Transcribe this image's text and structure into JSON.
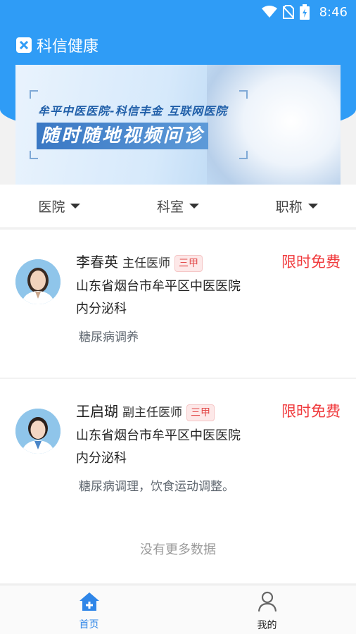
{
  "status_bar": {
    "time": "8:46"
  },
  "app": {
    "title": "科信健康"
  },
  "banner": {
    "line1": "牟平中医医院-科信丰金  互联网医院",
    "line2": "随时随地视频问诊"
  },
  "filters": [
    {
      "label": "医院"
    },
    {
      "label": "科室"
    },
    {
      "label": "职称"
    }
  ],
  "doctors": [
    {
      "name": "李春英",
      "title": "主任医师",
      "badge": "三甲",
      "price": "限时免费",
      "hospital": "山东省烟台市牟平区中医医院",
      "department": "内分泌科",
      "specialty": "糖尿病调养"
    },
    {
      "name": "王启瑚",
      "title": "副主任医师",
      "badge": "三甲",
      "price": "限时免费",
      "hospital": "山东省烟台市牟平区中医医院",
      "department": "内分泌科",
      "specialty": "糖尿病调理，饮食运动调整。"
    }
  ],
  "list_footer": "没有更多数据",
  "tabbar": [
    {
      "label": "首页",
      "icon": "home-plus-icon",
      "active": true
    },
    {
      "label": "我的",
      "icon": "person-icon",
      "active": false
    }
  ],
  "colors": {
    "primary": "#2f9cf6",
    "price": "#f0383b",
    "active_tab": "#2f86e8"
  }
}
